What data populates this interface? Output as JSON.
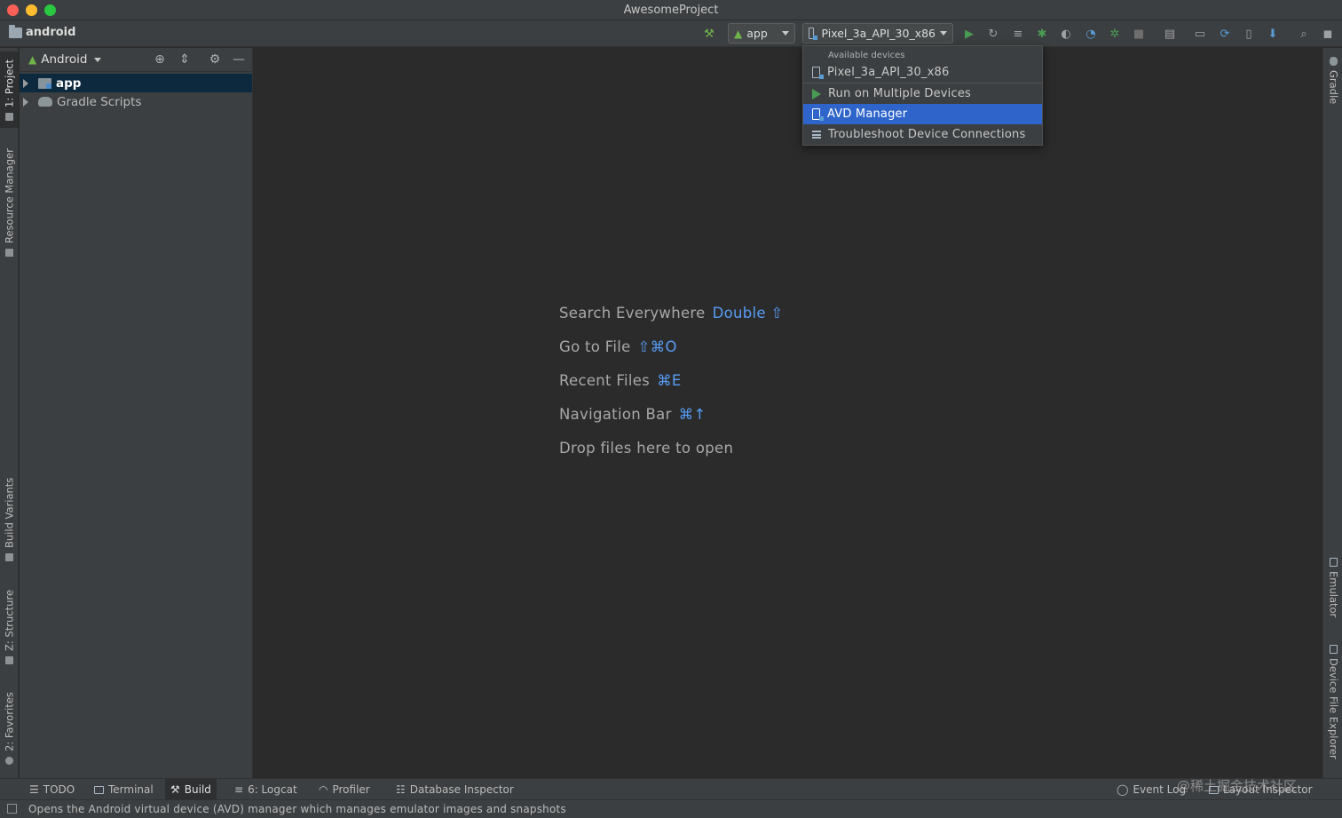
{
  "window": {
    "title": "AwesomeProject"
  },
  "toolbar": {
    "project_name": "android",
    "run_config": "app",
    "device": "Pixel_3a_API_30_x86"
  },
  "project_panel": {
    "view_mode": "Android",
    "tree": [
      {
        "label": "app",
        "selected": true
      },
      {
        "label": "Gradle Scripts",
        "selected": false
      }
    ]
  },
  "left_tabs": {
    "project": "1: Project",
    "resource_manager": "Resource Manager",
    "build_variants": "Build Variants",
    "structure": "Z: Structure",
    "favorites": "2: Favorites"
  },
  "right_tabs": {
    "gradle": "Gradle",
    "emulator": "Emulator",
    "device_file_explorer": "Device File Explorer"
  },
  "device_menu": {
    "section": "Available devices",
    "device": "Pixel_3a_API_30_x86",
    "run_multiple": "Run on Multiple Devices",
    "avd_manager": "AVD Manager",
    "troubleshoot": "Troubleshoot Device Connections"
  },
  "editor_hints": [
    {
      "label": "Search Everywhere",
      "shortcut": "Double ⇧"
    },
    {
      "label": "Go to File",
      "shortcut": "⇧⌘O"
    },
    {
      "label": "Recent Files",
      "shortcut": "⌘E"
    },
    {
      "label": "Navigation Bar",
      "shortcut": "⌘↑"
    },
    {
      "label": "Drop files here to open",
      "shortcut": ""
    }
  ],
  "bottom_tabs": {
    "todo": "TODO",
    "terminal": "Terminal",
    "build": "Build",
    "logcat": "6: Logcat",
    "profiler": "Profiler",
    "database_inspector": "Database Inspector",
    "event_log": "Event Log",
    "layout_inspector": "Layout Inspector"
  },
  "status": {
    "message": "Opens the Android virtual device (AVD) manager which manages emulator images and snapshots"
  },
  "watermark": "@稀土掘金技术社区",
  "colors": {
    "accent_blue": "#589df6",
    "selection": "#2f65ca",
    "run_green": "#499c54"
  }
}
